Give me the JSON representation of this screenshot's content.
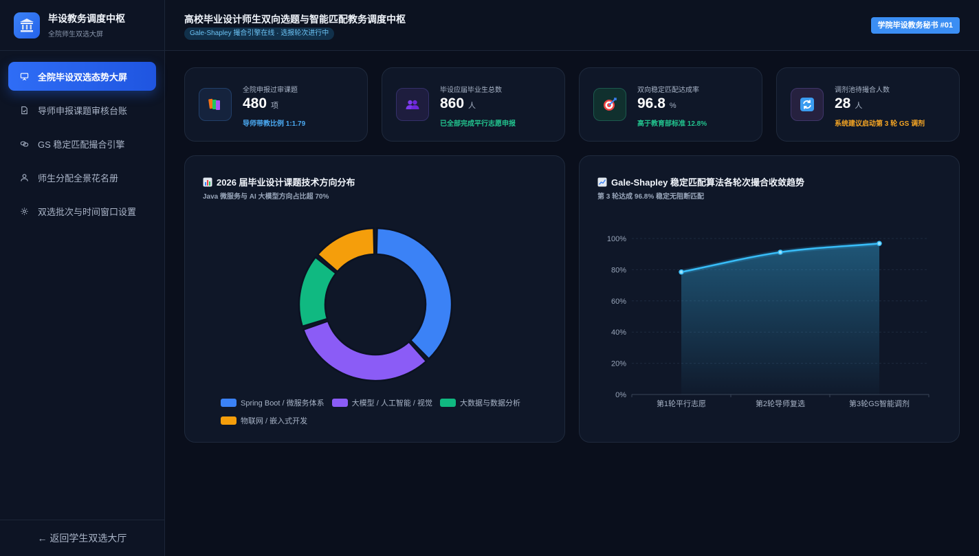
{
  "brand": {
    "title": "毕设教务调度中枢",
    "subtitle": "全院师生双选大屏",
    "icon": "institution-icon"
  },
  "sidebar": {
    "items": [
      {
        "label": "全院毕设双选态势大屏",
        "icon": "presentation-icon",
        "active": true
      },
      {
        "label": "导师申报课题审核台账",
        "icon": "file-check-icon",
        "active": false
      },
      {
        "label": "GS 稳定匹配撮合引擎",
        "icon": "link-icon",
        "active": false
      },
      {
        "label": "师生分配全景花名册",
        "icon": "user-icon",
        "active": false
      },
      {
        "label": "双选批次与时间窗口设置",
        "icon": "gear-icon",
        "active": false
      }
    ],
    "back_label": "← 返回学生双选大厅"
  },
  "header": {
    "title": "高校毕业设计师生双向选题与智能匹配教务调度中枢",
    "status_badge": "Gale-Shapley 撮合引擎在线 · 选报轮次进行中",
    "user_badge": "学院毕设教务秘书 #01"
  },
  "kpis": [
    {
      "label": "全院申报过审课题",
      "value": "480",
      "unit": "项",
      "note": "导师带教比例 1:1.79",
      "note_color": "#4aa8f0",
      "icon": "books-icon"
    },
    {
      "label": "毕设应届毕业生总数",
      "value": "860",
      "unit": "人",
      "note": "已全部完成平行志愿申报",
      "note_color": "#22c38e",
      "icon": "people-icon"
    },
    {
      "label": "双向稳定匹配达成率",
      "value": "96.8",
      "unit": "%",
      "note": "高于教育部标准 12.8%",
      "note_color": "#22c38e",
      "icon": "target-icon"
    },
    {
      "label": "调剂池待撮合人数",
      "value": "28",
      "unit": "人",
      "note": "系统建议启动第 3 轮 GS 调剂",
      "note_color": "#f5a524",
      "icon": "refresh-icon"
    }
  ],
  "donut_panel": {
    "title": "2026 届毕业设计课题技术方向分布",
    "subtitle": "Java 微服务与 AI 大模型方向占比超 70%",
    "icon": "bar-chart-icon"
  },
  "line_panel": {
    "title": "Gale-Shapley 稳定匹配算法各轮次撮合收敛趋势",
    "subtitle": "第 3 轮达成 96.8% 稳定无阻断匹配",
    "icon": "trend-chart-icon"
  },
  "chart_data": [
    {
      "type": "pie",
      "categories": [
        "Spring Boot / 微服务体系",
        "大模型 / 人工智能 / 视觉",
        "大数据与数据分析",
        "物联网 / 嵌入式开发"
      ],
      "values": [
        38,
        32,
        16,
        14
      ],
      "colors": [
        "#3b82f6",
        "#8b5cf6",
        "#10b981",
        "#f59e0b"
      ],
      "legend": "bottom"
    },
    {
      "type": "area",
      "categories": [
        "第1轮平行志愿",
        "第2轮导师复选",
        "第3轮GS智能调剂"
      ],
      "series": [
        {
          "values": [
            78.5,
            91.2,
            96.8
          ],
          "color": "#38bdf8"
        }
      ],
      "yticks": [
        "0%",
        "20%",
        "40%",
        "60%",
        "80%",
        "100%"
      ],
      "ylim": [
        0,
        100
      ],
      "grid": true
    }
  ]
}
